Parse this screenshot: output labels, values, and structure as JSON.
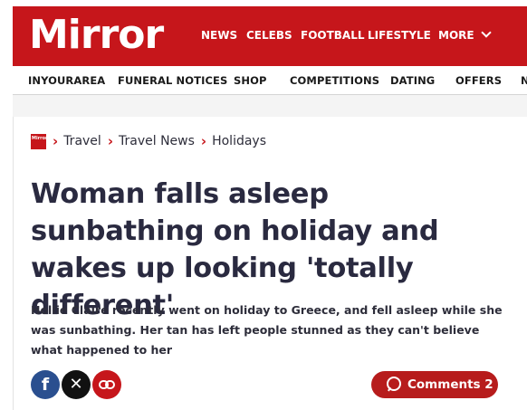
{
  "header": {
    "logo_text": "Mirror",
    "brand_color": "#c6161b",
    "nav": [
      {
        "label": "NEWS"
      },
      {
        "label": "CELEBS"
      },
      {
        "label": "FOOTBALL"
      },
      {
        "label": "LIFESTYLE"
      },
      {
        "label": "MORE"
      }
    ]
  },
  "subnav": {
    "items": [
      {
        "label": "INYOURAREA"
      },
      {
        "label": "FUNERAL NOTICES"
      },
      {
        "label": "SHOP"
      },
      {
        "label": "COMPETITIONS"
      },
      {
        "label": "DATING"
      },
      {
        "label": "OFFERS"
      },
      {
        "label": "N"
      }
    ]
  },
  "breadcrumb": {
    "logo_text": "Mirror",
    "items": [
      {
        "label": "Travel"
      },
      {
        "label": "Travel News"
      },
      {
        "label": "Holidays"
      }
    ]
  },
  "article": {
    "headline": "Woman falls asleep sunbathing on holiday and wakes up looking 'totally different'",
    "standfirst": "Hollie Claire recently went on holiday to Greece, and fell asleep while she was sunbathing. Her tan has left people stunned as they can't believe what happened to her"
  },
  "share": {
    "icons": [
      "facebook-icon",
      "x-icon",
      "link-icon"
    ]
  },
  "comments": {
    "label": "Comments 2"
  }
}
